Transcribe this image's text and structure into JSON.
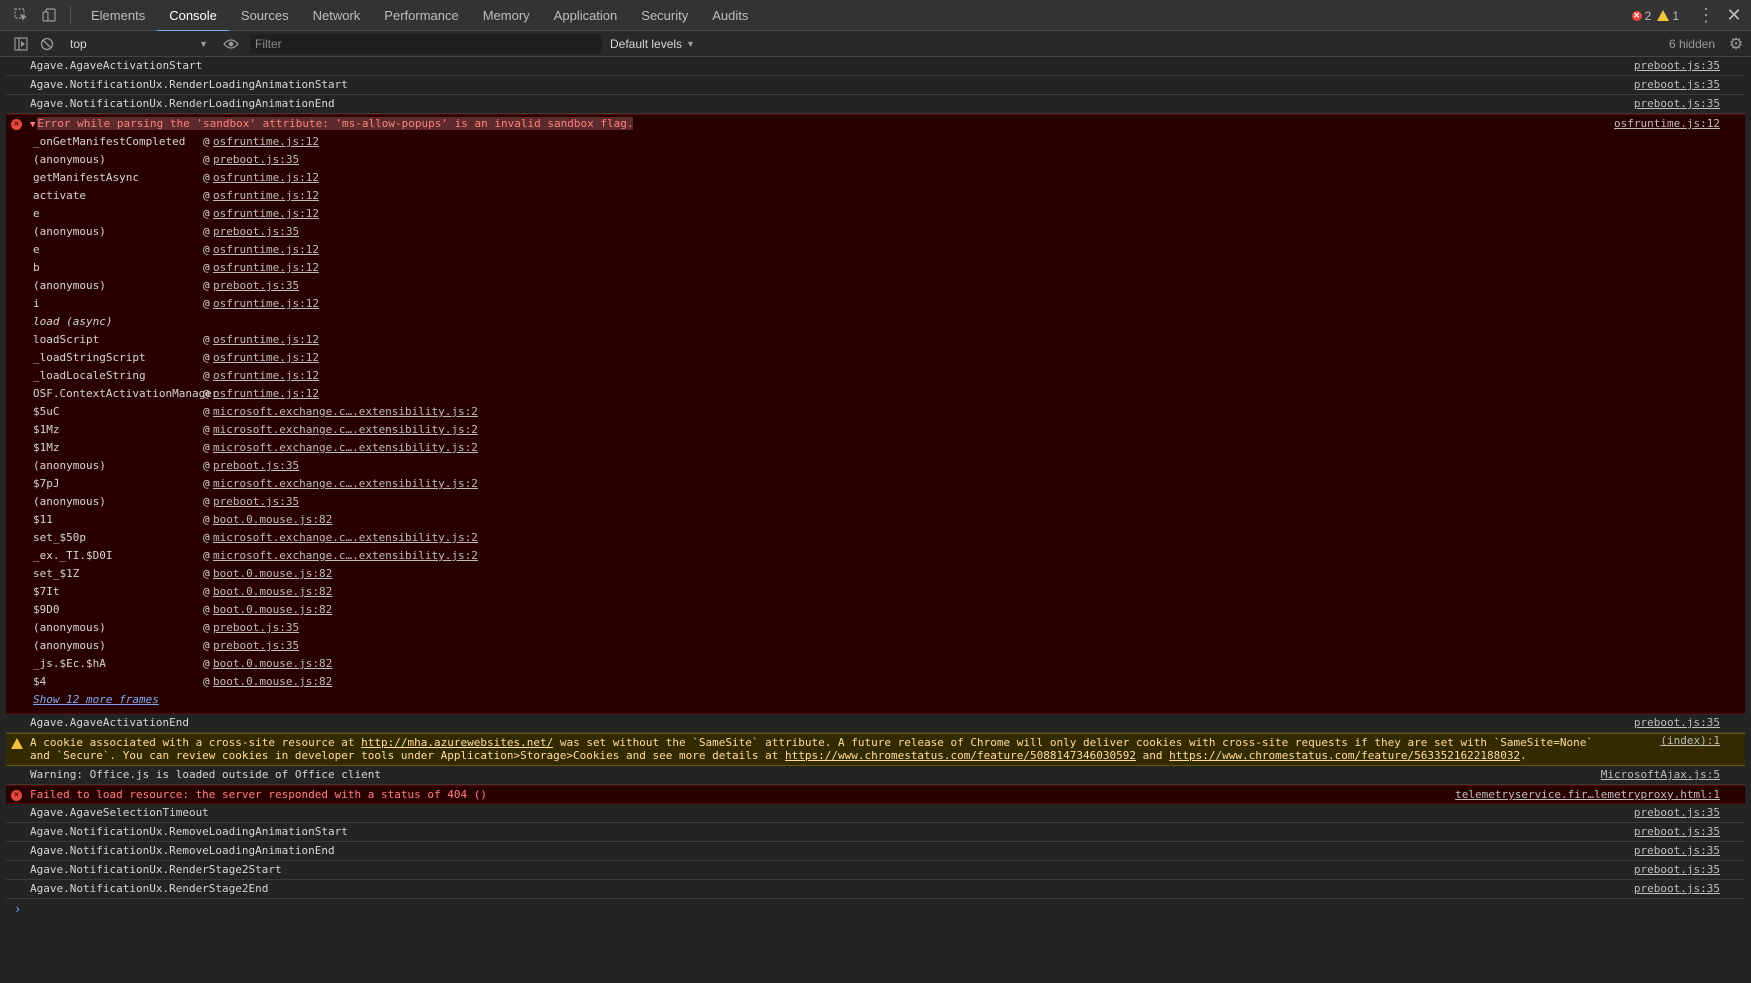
{
  "tabbar": {
    "tabs": [
      {
        "label": "Elements",
        "active": false
      },
      {
        "label": "Console",
        "active": true
      },
      {
        "label": "Sources",
        "active": false
      },
      {
        "label": "Network",
        "active": false
      },
      {
        "label": "Performance",
        "active": false
      },
      {
        "label": "Memory",
        "active": false
      },
      {
        "label": "Application",
        "active": false
      },
      {
        "label": "Security",
        "active": false
      },
      {
        "label": "Audits",
        "active": false
      }
    ],
    "error_count": "2",
    "warning_count": "1"
  },
  "toolbar": {
    "context": "top",
    "filter_placeholder": "Filter",
    "levels": "Default levels",
    "hidden": "6 hidden"
  },
  "colors": {
    "error_text": "#ff8080",
    "error_bg": "#290000",
    "warning_bg": "#332a00",
    "accent": "#7cacf8"
  },
  "messages_top": [
    {
      "text": "Agave.AgaveActivationStart",
      "source": "preboot.js:35"
    },
    {
      "text": "Agave.NotificationUx.RenderLoadingAnimationStart",
      "source": "preboot.js:35"
    },
    {
      "text": "Agave.NotificationUx.RenderLoadingAnimationEnd",
      "source": "preboot.js:35"
    }
  ],
  "error_block": {
    "message": "Error while parsing the 'sandbox' attribute: 'ms-allow-popups' is an invalid sandbox flag.",
    "source": "osfruntime.js:12",
    "frames": [
      {
        "fn": "_onGetManifestCompleted",
        "file": "osfruntime.js:12"
      },
      {
        "fn": "(anonymous)",
        "file": "preboot.js:35"
      },
      {
        "fn": "getManifestAsync",
        "file": "osfruntime.js:12"
      },
      {
        "fn": "activate",
        "file": "osfruntime.js:12"
      },
      {
        "fn": "e",
        "file": "osfruntime.js:12"
      },
      {
        "fn": "(anonymous)",
        "file": "preboot.js:35"
      },
      {
        "fn": "e",
        "file": "osfruntime.js:12"
      },
      {
        "fn": "b",
        "file": "osfruntime.js:12"
      },
      {
        "fn": "(anonymous)",
        "file": "preboot.js:35"
      },
      {
        "fn": "i",
        "file": "osfruntime.js:12"
      },
      {
        "fn": "load (async)",
        "file": "",
        "async": true
      },
      {
        "fn": "loadScript",
        "file": "osfruntime.js:12"
      },
      {
        "fn": "_loadStringScript",
        "file": "osfruntime.js:12"
      },
      {
        "fn": "_loadLocaleString",
        "file": "osfruntime.js:12"
      },
      {
        "fn": "OSF.ContextActivationManager",
        "file": "osfruntime.js:12"
      },
      {
        "fn": "$5uC",
        "file": "microsoft.exchange.c….extensibility.js:2"
      },
      {
        "fn": "$1Mz",
        "file": "microsoft.exchange.c….extensibility.js:2"
      },
      {
        "fn": "$1Mz",
        "file": "microsoft.exchange.c….extensibility.js:2"
      },
      {
        "fn": "(anonymous)",
        "file": "preboot.js:35"
      },
      {
        "fn": "$7pJ",
        "file": "microsoft.exchange.c….extensibility.js:2"
      },
      {
        "fn": "(anonymous)",
        "file": "preboot.js:35"
      },
      {
        "fn": "$11",
        "file": "boot.0.mouse.js:82"
      },
      {
        "fn": "set_$50p",
        "file": "microsoft.exchange.c….extensibility.js:2"
      },
      {
        "fn": "_ex._TI.$D0I",
        "file": "microsoft.exchange.c….extensibility.js:2"
      },
      {
        "fn": "set_$1Z",
        "file": "boot.0.mouse.js:82"
      },
      {
        "fn": "$7It",
        "file": "boot.0.mouse.js:82"
      },
      {
        "fn": "$9D0",
        "file": "boot.0.mouse.js:82"
      },
      {
        "fn": "(anonymous)",
        "file": "preboot.js:35"
      },
      {
        "fn": "(anonymous)",
        "file": "preboot.js:35"
      },
      {
        "fn": "_js.$Ec.$hA",
        "file": "boot.0.mouse.js:82"
      },
      {
        "fn": "$4",
        "file": "boot.0.mouse.js:82"
      }
    ],
    "more_frames": "Show 12 more frames"
  },
  "activation_end": {
    "text": "Agave.AgaveActivationEnd",
    "source": "preboot.js:35"
  },
  "cookie_warning": {
    "part1": "A cookie associated with a cross-site resource at ",
    "link1": "http://mha.azurewebsites.net/",
    "part2": " was set without the `SameSite` attribute. A future release of Chrome will only deliver cookies with cross-site requests if they are set with `SameSite=None` and `Secure`. You can review cookies in developer tools under Application>Storage>Cookies and see more details at ",
    "link2": "https://www.chromestatus.com/feature/5088147346030592",
    "part3": " and ",
    "link3": "https://www.chromestatus.com/feature/5633521622188032",
    "part4": ".",
    "source": "(index):1"
  },
  "office_warning": {
    "text": "Warning: Office.js is loaded outside of Office client",
    "source": "MicrosoftAjax.js:5"
  },
  "resource_error": {
    "text": "Failed to load resource: the server responded with a status of 404 ()",
    "source": "telemetryservice.fir…lemetryproxy.html:1"
  },
  "messages_bottom": [
    {
      "text": "Agave.AgaveSelectionTimeout",
      "source": "preboot.js:35"
    },
    {
      "text": "Agave.NotificationUx.RemoveLoadingAnimationStart",
      "source": "preboot.js:35"
    },
    {
      "text": "Agave.NotificationUx.RemoveLoadingAnimationEnd",
      "source": "preboot.js:35"
    },
    {
      "text": "Agave.NotificationUx.RenderStage2Start",
      "source": "preboot.js:35"
    },
    {
      "text": "Agave.NotificationUx.RenderStage2End",
      "source": "preboot.js:35"
    }
  ],
  "prompt": "›"
}
